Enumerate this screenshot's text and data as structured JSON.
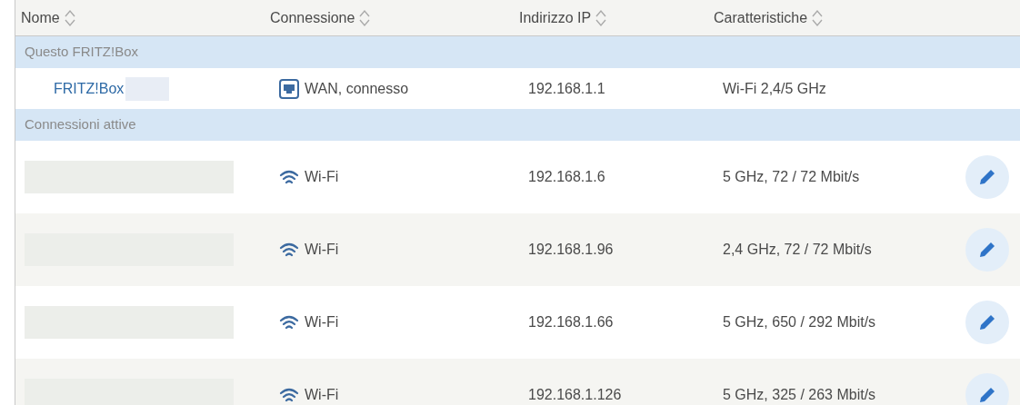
{
  "table": {
    "columns": [
      {
        "label": "Nome",
        "sortable": true
      },
      {
        "label": "Connessione",
        "sortable": true
      },
      {
        "label": "Indirizzo IP",
        "sortable": true
      },
      {
        "label": "Caratteristiche",
        "sortable": true
      }
    ],
    "groups": [
      {
        "title": "Questo FRITZ!Box",
        "rows": [
          {
            "name": "FRITZ!Box",
            "name_redacted": true,
            "connection": {
              "kind": "lan",
              "label": "WAN, connesso"
            },
            "ip": "192.168.1.1",
            "features": "Wi-Fi 2,4/5 GHz",
            "editable": false
          }
        ]
      },
      {
        "title": "Connessioni attive",
        "rows": [
          {
            "name_redacted": true,
            "connection": {
              "kind": "wifi",
              "label": "Wi-Fi"
            },
            "ip": "192.168.1.6",
            "features": "5 GHz, 72 / 72 Mbit/s",
            "editable": true
          },
          {
            "name_redacted": true,
            "connection": {
              "kind": "wifi",
              "label": "Wi-Fi"
            },
            "ip": "192.168.1.96",
            "features": "2,4 GHz, 72 / 72 Mbit/s",
            "editable": true
          },
          {
            "name_redacted": true,
            "connection": {
              "kind": "wifi",
              "label": "Wi-Fi"
            },
            "ip": "192.168.1.66",
            "features": "5 GHz, 650 / 292 Mbit/s",
            "editable": true
          },
          {
            "name_redacted": true,
            "connection": {
              "kind": "wifi",
              "label": "Wi-Fi"
            },
            "ip": "192.168.1.126",
            "features": "5 GHz, 325 / 263 Mbit/s",
            "editable": true
          }
        ]
      }
    ]
  }
}
